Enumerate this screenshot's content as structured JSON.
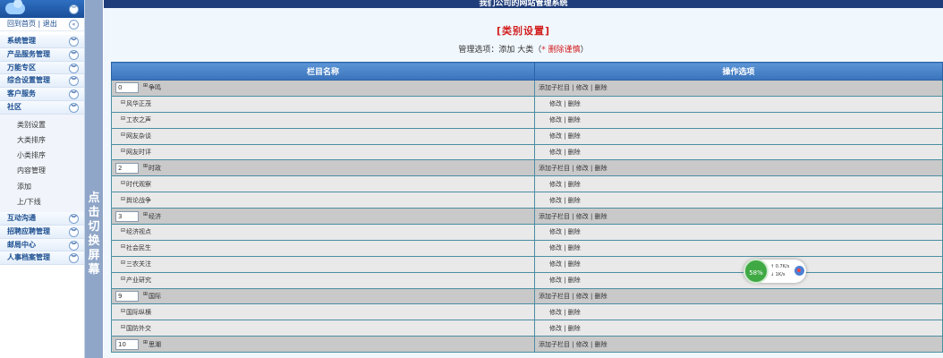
{
  "sidebar": {
    "home_link": "回到首页",
    "sep": "|",
    "logout_link": "退出",
    "menus_top": [
      {
        "label": "系统管理"
      },
      {
        "label": "产品服务管理"
      },
      {
        "label": "万能专区"
      },
      {
        "label": "综合设置管理"
      },
      {
        "label": "客户服务"
      },
      {
        "label": "社区"
      }
    ],
    "submenu": [
      {
        "label": "类别设置"
      },
      {
        "label": "大类排序"
      },
      {
        "label": "小类排序"
      },
      {
        "label": "内容管理"
      },
      {
        "label": "添加"
      },
      {
        "label": "上/下线"
      }
    ],
    "menus_bottom": [
      {
        "label": "互动沟通"
      },
      {
        "label": "招聘应聘管理"
      },
      {
        "label": "邮局中心"
      },
      {
        "label": "人事档案管理"
      }
    ],
    "toggle_text": [
      "点",
      "击",
      "切",
      "换",
      "屏",
      "幕"
    ]
  },
  "header": {
    "title": "我们公司的网站管理系统"
  },
  "page": {
    "heading": "[类别设置]",
    "mgmt_label": "管理选项：添加 大类（",
    "mgmt_warn": "* 删除谨慎",
    "mgmt_close": "）"
  },
  "table": {
    "col1": "栏目名称",
    "col2": "操作选项",
    "rows": [
      {
        "type": "cat",
        "order": "0",
        "name": "争鸣",
        "ops": "添加子栏目 | 修改 | 删除"
      },
      {
        "type": "sub",
        "name": "风华正茂",
        "ops": "修改 | 删除"
      },
      {
        "type": "sub",
        "name": "工农之声",
        "ops": "修改 | 删除"
      },
      {
        "type": "sub",
        "name": "网友杂谈",
        "ops": "修改 | 删除"
      },
      {
        "type": "sub",
        "name": "网友时评",
        "ops": "修改 | 删除"
      },
      {
        "type": "cat",
        "order": "2",
        "name": "时政",
        "ops": "添加子栏目 | 修改 | 删除"
      },
      {
        "type": "sub",
        "name": "时代观察",
        "ops": "修改 | 删除"
      },
      {
        "type": "sub",
        "name": "舆论战争",
        "ops": "修改 | 删除"
      },
      {
        "type": "cat",
        "order": "3",
        "name": "经济",
        "ops": "添加子栏目 | 修改 | 删除"
      },
      {
        "type": "sub",
        "name": "经济视点",
        "ops": "修改 | 删除"
      },
      {
        "type": "sub",
        "name": "社会民生",
        "ops": "修改 | 删除"
      },
      {
        "type": "sub",
        "name": "三农关注",
        "ops": "修改 | 删除"
      },
      {
        "type": "sub",
        "name": "产业研究",
        "ops": "修改 | 删除"
      },
      {
        "type": "cat",
        "order": "9",
        "name": "国际",
        "ops": "添加子栏目 | 修改 | 删除"
      },
      {
        "type": "sub",
        "name": "国际纵横",
        "ops": "修改 | 删除"
      },
      {
        "type": "sub",
        "name": "国防外交",
        "ops": "修改 | 删除"
      },
      {
        "type": "cat",
        "order": "10",
        "name": "思潮",
        "ops": "添加子栏目 | 修改 | 删除"
      }
    ]
  },
  "widget": {
    "percent": "58%",
    "up": "0.7K/s",
    "down": "1K/s"
  }
}
